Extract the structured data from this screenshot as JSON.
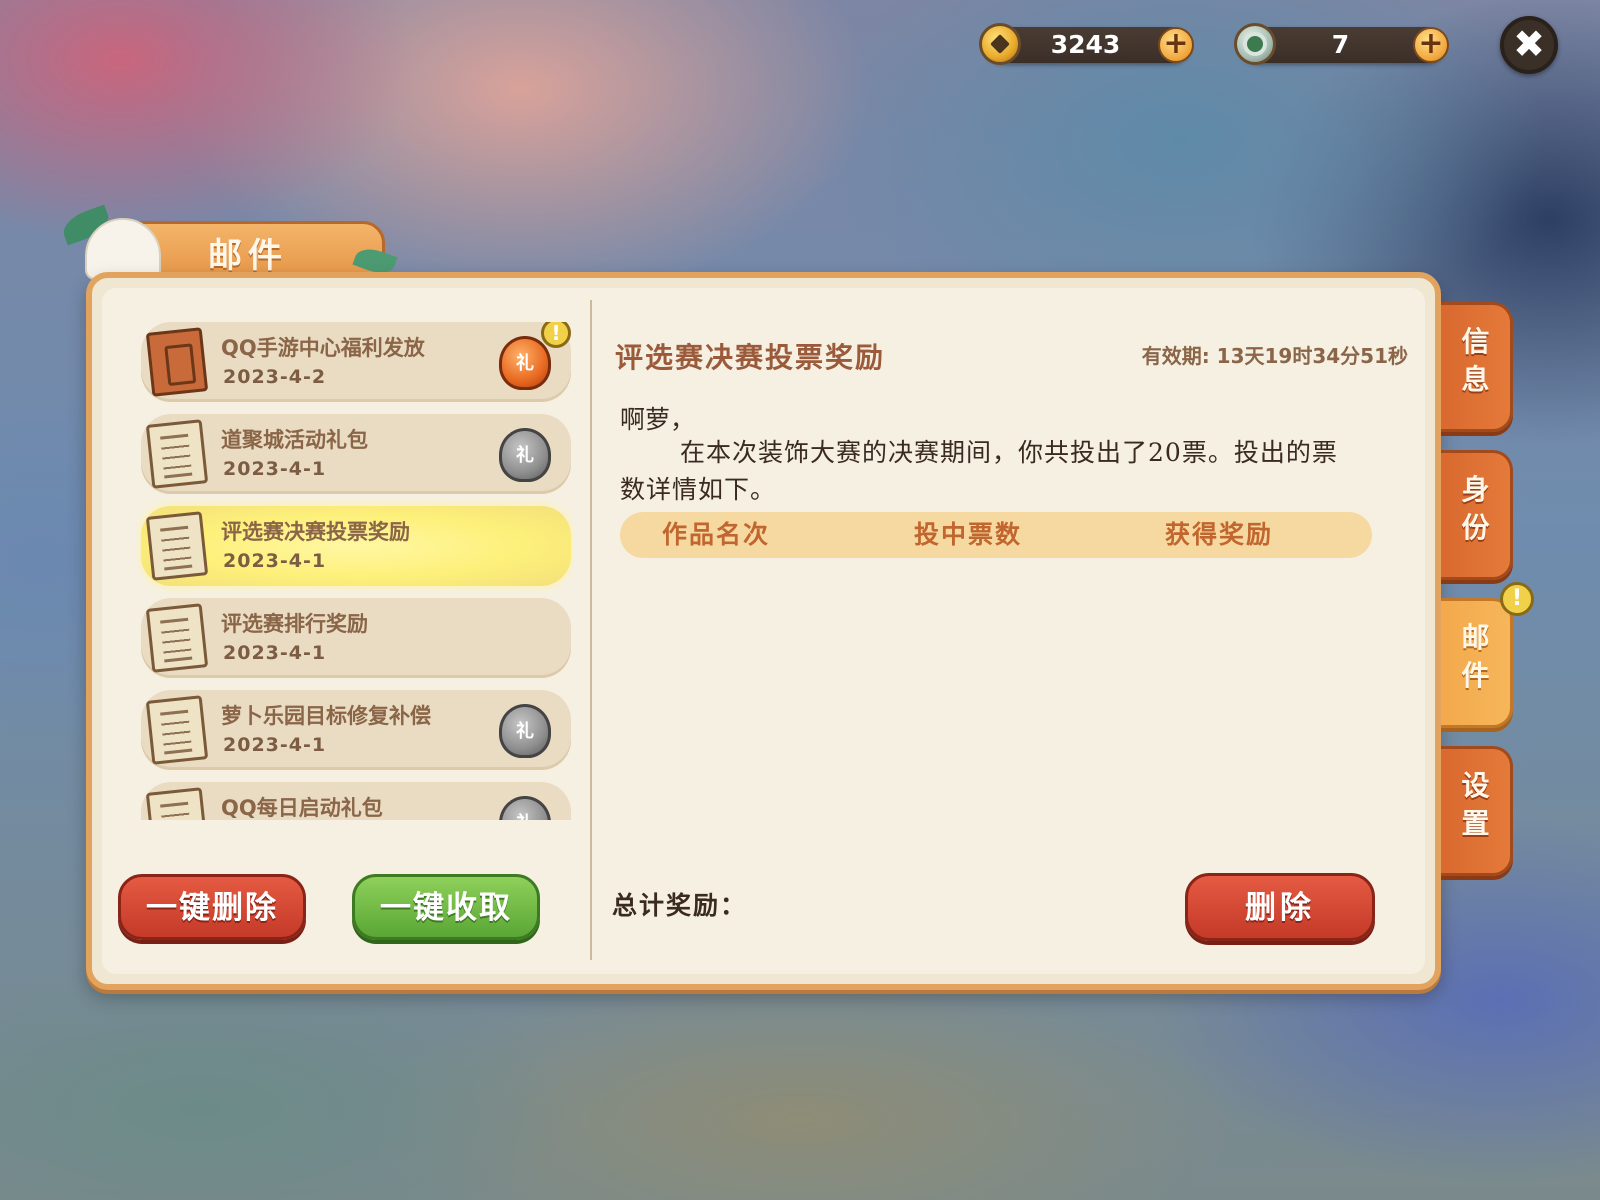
{
  "currency": {
    "gold": {
      "icon": "gold-coin-icon",
      "value": "3243"
    },
    "gem": {
      "icon": "green-gem-icon",
      "value": "7"
    },
    "plus_symbol": "+"
  },
  "close_symbol": "✖",
  "title": "邮件",
  "mail_list": [
    {
      "title": "QQ手游中心福利发放",
      "date": "2023-4-2",
      "icon": "red-letter-icon",
      "gift": "hot-gift-bag-icon",
      "gift_label": "礼",
      "badge": "!"
    },
    {
      "title": "道聚城活动礼包",
      "date": "2023-4-1",
      "icon": "letter-icon",
      "gift": "gift-bag-icon",
      "gift_label": "礼"
    },
    {
      "title": "评选赛决赛投票奖励",
      "date": "2023-4-1",
      "icon": "letter-icon",
      "selected": true
    },
    {
      "title": "评选赛排行奖励",
      "date": "2023-4-1",
      "icon": "letter-icon"
    },
    {
      "title": "萝卜乐园目标修复补偿",
      "date": "2023-4-1",
      "icon": "letter-icon",
      "gift": "gift-bag-icon",
      "gift_label": "礼"
    },
    {
      "title": "QQ每日启动礼包",
      "date": "",
      "icon": "letter-icon",
      "gift": "gift-bag-icon",
      "gift_label": "礼"
    }
  ],
  "buttons": {
    "delete_all": "一键删除",
    "collect_all": "一键收取",
    "delete": "删除"
  },
  "detail": {
    "title": "评选赛决赛投票奖励",
    "validity": "有效期: 13天19时34分51秒",
    "greeting": "啊萝，",
    "body": "在本次装饰大赛的决赛期间，你共投出了20票。投出的票数详情如下。",
    "table_headers": [
      "作品名次",
      "投中票数",
      "获得奖励"
    ],
    "total_label": "总计奖励："
  },
  "side_tabs": [
    {
      "label": "信息",
      "active": false
    },
    {
      "label": "身份",
      "active": false
    },
    {
      "label": "邮件",
      "active": true,
      "badge": "!"
    },
    {
      "label": "设置",
      "active": false
    }
  ],
  "colors": {
    "accent_orange": "#e89a4c",
    "selected_item": "#fdf07a",
    "button_red": "#d8492f",
    "button_green": "#6fba44"
  }
}
